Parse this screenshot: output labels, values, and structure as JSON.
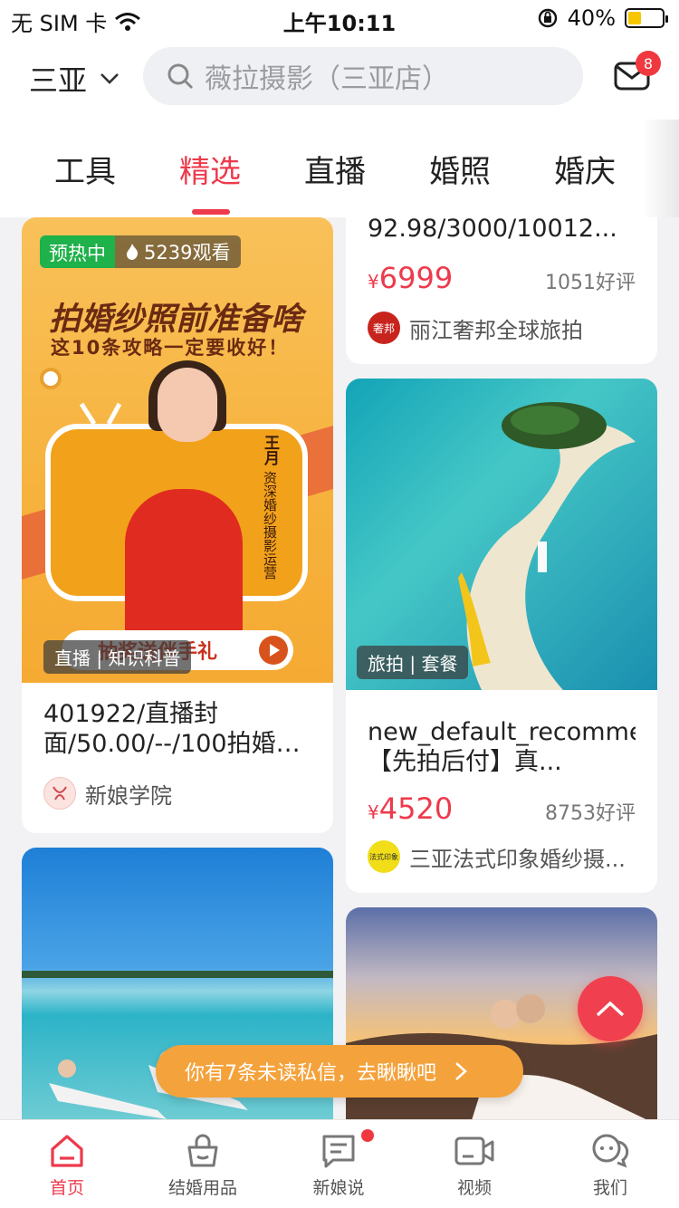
{
  "status_bar": {
    "carrier": "无 SIM 卡",
    "time": "上午10:11",
    "battery_percent": "40%",
    "battery_level": 0.4
  },
  "header": {
    "city": "三亚",
    "search_placeholder": "薇拉摄影（三亚店）",
    "message_badge": "8"
  },
  "tabs": [
    {
      "label": "工具",
      "active": false
    },
    {
      "label": "精选",
      "active": true
    },
    {
      "label": "直播",
      "active": false
    },
    {
      "label": "婚照",
      "active": false
    },
    {
      "label": "婚庆",
      "active": false
    }
  ],
  "cards": {
    "live": {
      "hot_badge": "预热中",
      "views": "5239观看",
      "poster_title": "拍婚纱照前准备啥",
      "poster_subtitle": "这10条攻略一定要收好！",
      "presenter_name": "王月",
      "presenter_role": "资深婚纱摄影运营",
      "gift_text": "抽奖送伴手礼",
      "tag": "直播 | 知识科普",
      "title": "401922/直播封面/50.00/--/100拍婚纱...",
      "shop": "新娘学院"
    },
    "lijiang": {
      "title": "92.98/3000/10012...",
      "price_symbol": "¥",
      "price": "6999",
      "reviews": "1051好评",
      "shop": "丽江奢邦全球旅拍",
      "logo_text": "奢邦"
    },
    "sanya": {
      "tag": "旅拍 | 套餐",
      "title": "new_default_recommend-【先拍后付】真...",
      "price_symbol": "¥",
      "price": "4520",
      "reviews": "8753好评",
      "shop": "三亚法式印象婚纱摄...",
      "logo_text": "法式印象"
    }
  },
  "toast": {
    "text": "你有7条未读私信，去瞅瞅吧"
  },
  "bottom_nav": [
    {
      "label": "首页",
      "active": true
    },
    {
      "label": "结婚用品",
      "active": false
    },
    {
      "label": "新娘说",
      "active": false
    },
    {
      "label": "视频",
      "active": false
    },
    {
      "label": "我们",
      "active": false
    }
  ],
  "colors": {
    "accent": "#ed3a4c",
    "toast": "#f4a23b",
    "live_green": "#1fb14a"
  }
}
